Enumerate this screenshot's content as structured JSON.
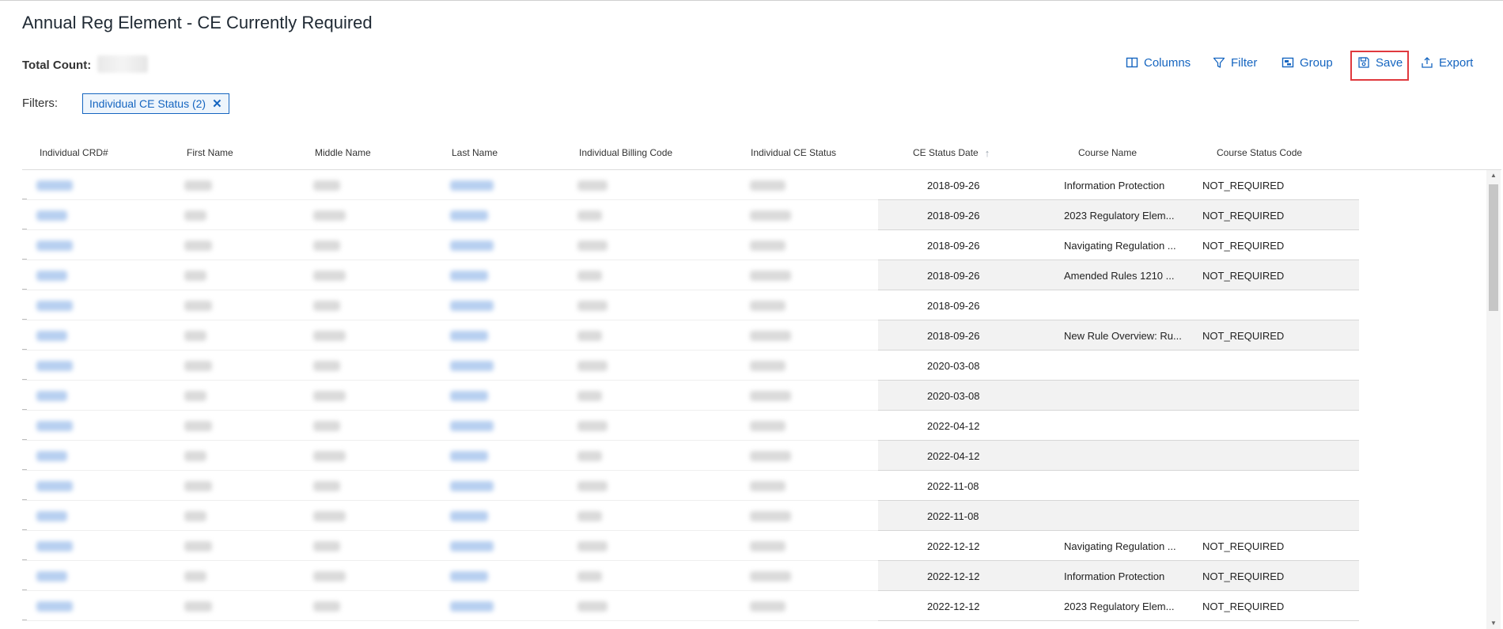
{
  "page": {
    "title": "Annual Reg Element - CE Currently Required",
    "total_count_label": "Total Count:",
    "total_count_value": "2"
  },
  "toolbar": {
    "columns_label": "Columns",
    "filter_label": "Filter",
    "group_label": "Group",
    "save_label": "Save",
    "export_label": "Export"
  },
  "filters": {
    "label": "Filters:",
    "chips": [
      {
        "label": "Individual CE Status (2)",
        "remove_glyph": "✕"
      }
    ]
  },
  "table": {
    "columns": [
      "Individual CRD#",
      "First Name",
      "Middle Name",
      "Last Name",
      "Individual Billing Code",
      "Individual CE Status",
      "CE Status Date",
      "Course Name",
      "Course Status Code"
    ],
    "sorted_column": "CE Status Date",
    "sort_direction": "ascending",
    "rows": [
      {
        "ce_status_date": "2018-09-26",
        "course_name": "Information Protection",
        "course_status_code": "NOT_REQUIRED"
      },
      {
        "ce_status_date": "2018-09-26",
        "course_name": "2023 Regulatory Elem...",
        "course_status_code": "NOT_REQUIRED"
      },
      {
        "ce_status_date": "2018-09-26",
        "course_name": "Navigating Regulation ...",
        "course_status_code": "NOT_REQUIRED"
      },
      {
        "ce_status_date": "2018-09-26",
        "course_name": "Amended Rules 1210 ...",
        "course_status_code": "NOT_REQUIRED"
      },
      {
        "ce_status_date": "2018-09-26",
        "course_name": "",
        "course_status_code": ""
      },
      {
        "ce_status_date": "2018-09-26",
        "course_name": "New Rule Overview: Ru...",
        "course_status_code": "NOT_REQUIRED"
      },
      {
        "ce_status_date": "2020-03-08",
        "course_name": "",
        "course_status_code": ""
      },
      {
        "ce_status_date": "2020-03-08",
        "course_name": "",
        "course_status_code": ""
      },
      {
        "ce_status_date": "2022-04-12",
        "course_name": "",
        "course_status_code": ""
      },
      {
        "ce_status_date": "2022-04-12",
        "course_name": "",
        "course_status_code": ""
      },
      {
        "ce_status_date": "2022-11-08",
        "course_name": "",
        "course_status_code": ""
      },
      {
        "ce_status_date": "2022-11-08",
        "course_name": "",
        "course_status_code": ""
      },
      {
        "ce_status_date": "2022-12-12",
        "course_name": "Navigating Regulation ...",
        "course_status_code": "NOT_REQUIRED"
      },
      {
        "ce_status_date": "2022-12-12",
        "course_name": "Information Protection",
        "course_status_code": "NOT_REQUIRED"
      },
      {
        "ce_status_date": "2022-12-12",
        "course_name": "2023 Regulatory Elem...",
        "course_status_code": "NOT_REQUIRED"
      }
    ]
  },
  "icons": {
    "columns": "columns-icon",
    "filter": "filter-icon",
    "group": "group-icon",
    "save": "save-icon",
    "export": "export-icon",
    "sort": "sort-ascending-icon"
  },
  "colors": {
    "accent": "#1565c0",
    "highlight": "#e0393e",
    "row_shade": "#f2f2f2"
  }
}
